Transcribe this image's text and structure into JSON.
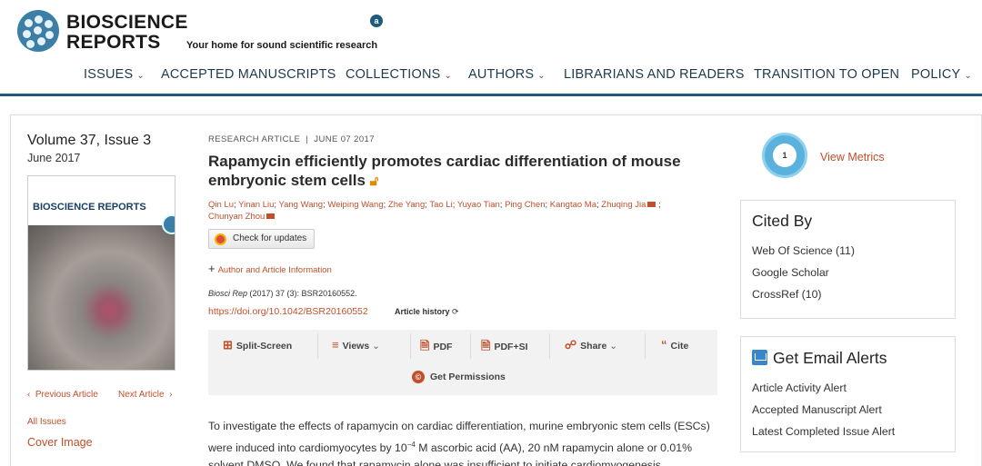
{
  "header": {
    "logo_line1": "BIOSCIENCE",
    "logo_line2": "REPORTS",
    "tagline": "Your home for sound scientific research",
    "oa_badge": "a"
  },
  "nav": {
    "items": [
      {
        "label": "ISSUES",
        "dropdown": true
      },
      {
        "label": "ACCEPTED MANUSCRIPTS",
        "dropdown": false
      },
      {
        "label": "COLLECTIONS",
        "dropdown": true
      },
      {
        "label": "AUTHORS",
        "dropdown": true
      },
      {
        "label": "LIBRARIANS AND READERS",
        "dropdown": false
      },
      {
        "label": "TRANSITION TO OPEN",
        "dropdown": false
      },
      {
        "label": "POLICY",
        "dropdown": true
      }
    ]
  },
  "issue": {
    "volume": "Volume 37, Issue 3",
    "date": "June 2017",
    "cover_title": "BIOSCIENCE REPORTS",
    "prev_label": "Previous Article",
    "next_label": "Next Article",
    "all_issues": "All Issues",
    "cover_image_link": "Cover Image"
  },
  "article": {
    "type": "RESEARCH ARTICLE",
    "date": "JUNE 07 2017",
    "title": "Rapamycin efficiently promotes cardiac differentiation of mouse embryonic stem cells",
    "authors": [
      "Qin Lu",
      "Yinan Liu",
      "Yang Wang",
      "Weiping Wang",
      "Zhe Yang",
      "Tao Li",
      "Yuyao Tian",
      "Ping Chen",
      "Kangtao Ma",
      "Zhuqing Jia",
      "Chunyan Zhou"
    ],
    "check_updates": "Check for updates",
    "author_info": "Author and Article Information",
    "citation_journal": "Biosci Rep",
    "citation_rest": " (2017) 37 (3): BSR20160552.",
    "doi": "https://doi.org/10.1042/BSR20160552",
    "history": "Article history"
  },
  "toolbar": {
    "split": "Split-Screen",
    "views": "Views",
    "pdf": "PDF",
    "pdfsi": "PDF+SI",
    "share": "Share",
    "cite": "Cite",
    "permissions": "Get Permissions"
  },
  "abstract": {
    "part1": "To investigate the effects of rapamycin on cardiac differentiation, murine embryonic stem cells (ESCs) were induced into cardiomyocytes by 10",
    "sup": "−4",
    "part2": " M ascorbic acid (AA), 20 nM rapamycin alone or 0.01% solvent DMSO. We found that rapamycin alone was insufficient to initiate cardiomyogenesis."
  },
  "metrics": {
    "count": "1",
    "label": "View Metrics"
  },
  "cited_by": {
    "title": "Cited By",
    "items": [
      "Web Of Science (11)",
      "Google Scholar",
      "CrossRef (10)"
    ]
  },
  "alerts": {
    "title": "Get Email Alerts",
    "items": [
      "Article Activity Alert",
      "Accepted Manuscript Alert",
      "Latest Completed Issue Alert"
    ]
  }
}
